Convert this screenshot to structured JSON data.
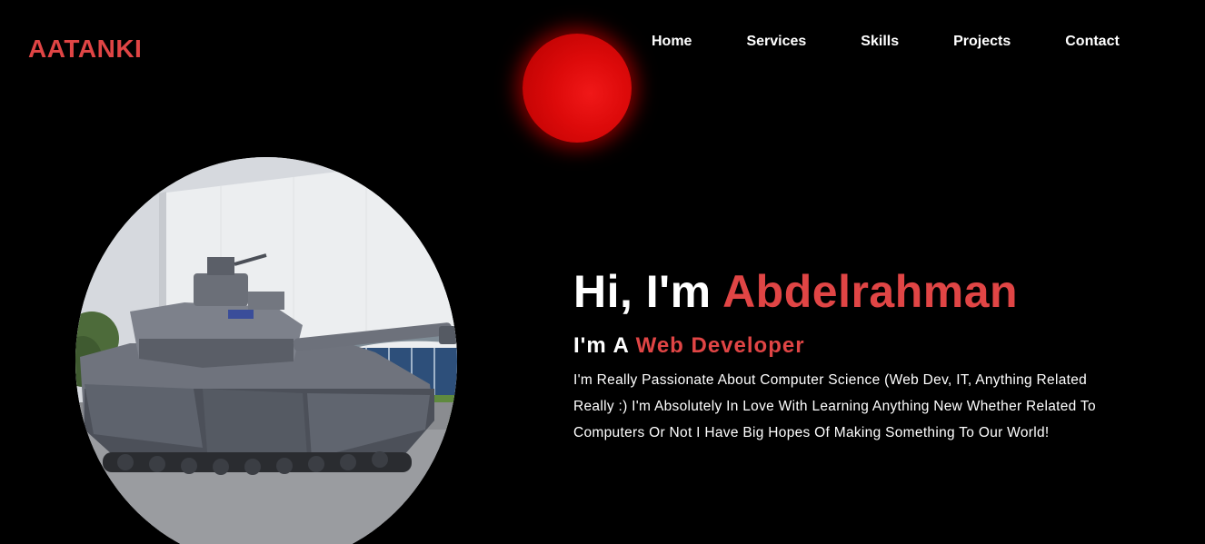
{
  "header": {
    "logo": "AATANKI",
    "nav": [
      "Home",
      "Services",
      "Skills",
      "Projects",
      "Contact"
    ]
  },
  "hero": {
    "greeting": "Hi, I'm ",
    "name": "Abdelrahman",
    "role_prefix": "I'm A ",
    "role": "Web Developer",
    "bio": "I'm Really Passionate About Computer Science (Web Dev, IT, Anything Related Really :) I'm Absolutely In Love With Learning Anything New Whether Related To Computers Or Not I Have Big Hopes Of Making Something To Our World!"
  },
  "image": {
    "subject": "tank-photo"
  },
  "colors": {
    "accent": "#e04545",
    "background": "#000000",
    "orb": "#dd0a0a"
  }
}
